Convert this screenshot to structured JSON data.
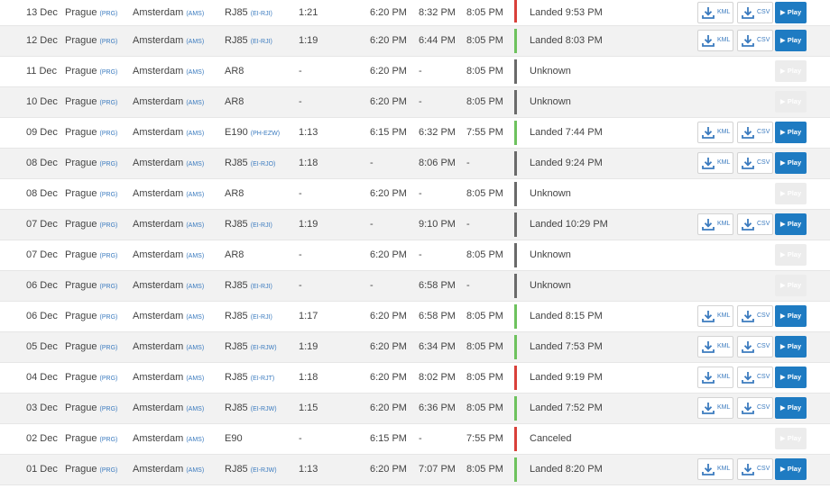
{
  "colors": {
    "landed": "#6ec25e",
    "late": "#d9403a",
    "unknown": "#6a6a6a",
    "play": "#1e7bc2",
    "code": "#3b7bbf"
  },
  "icons": {
    "download": "download-icon",
    "play": "play-triangle-icon"
  },
  "labels": {
    "kml": "KML",
    "csv": "CSV",
    "play": "▶ Play"
  },
  "rows": [
    {
      "date": "13 Dec",
      "from": "Prague",
      "from_code": "(PRG)",
      "to": "Amsterdam",
      "to_code": "(AMS)",
      "aircraft": "RJ85",
      "reg": "(EI-RJI)",
      "flight_time": "1:21",
      "std": "6:20 PM",
      "atd": "8:32 PM",
      "sta": "8:05 PM",
      "status": "Landed 9:53 PM",
      "bar": "red",
      "downloads": true
    },
    {
      "date": "12 Dec",
      "from": "Prague",
      "from_code": "(PRG)",
      "to": "Amsterdam",
      "to_code": "(AMS)",
      "aircraft": "RJ85",
      "reg": "(EI-RJI)",
      "flight_time": "1:19",
      "std": "6:20 PM",
      "atd": "6:44 PM",
      "sta": "8:05 PM",
      "status": "Landed 8:03 PM",
      "bar": "green",
      "downloads": true
    },
    {
      "date": "11 Dec",
      "from": "Prague",
      "from_code": "(PRG)",
      "to": "Amsterdam",
      "to_code": "(AMS)",
      "aircraft": "AR8",
      "reg": "",
      "flight_time": "-",
      "std": "6:20 PM",
      "atd": "-",
      "sta": "8:05 PM",
      "status": "Unknown",
      "bar": "gray",
      "downloads": false
    },
    {
      "date": "10 Dec",
      "from": "Prague",
      "from_code": "(PRG)",
      "to": "Amsterdam",
      "to_code": "(AMS)",
      "aircraft": "AR8",
      "reg": "",
      "flight_time": "-",
      "std": "6:20 PM",
      "atd": "-",
      "sta": "8:05 PM",
      "status": "Unknown",
      "bar": "gray",
      "downloads": false
    },
    {
      "date": "09 Dec",
      "from": "Prague",
      "from_code": "(PRG)",
      "to": "Amsterdam",
      "to_code": "(AMS)",
      "aircraft": "E190",
      "reg": "(PH-EZW)",
      "flight_time": "1:13",
      "std": "6:15 PM",
      "atd": "6:32 PM",
      "sta": "7:55 PM",
      "status": "Landed 7:44 PM",
      "bar": "green",
      "downloads": true
    },
    {
      "date": "08 Dec",
      "from": "Prague",
      "from_code": "(PRG)",
      "to": "Amsterdam",
      "to_code": "(AMS)",
      "aircraft": "RJ85",
      "reg": "(EI-RJO)",
      "flight_time": "1:18",
      "std": "-",
      "atd": "8:06 PM",
      "sta": "-",
      "status": "Landed 9:24 PM",
      "bar": "gray",
      "downloads": true
    },
    {
      "date": "08 Dec",
      "from": "Prague",
      "from_code": "(PRG)",
      "to": "Amsterdam",
      "to_code": "(AMS)",
      "aircraft": "AR8",
      "reg": "",
      "flight_time": "-",
      "std": "6:20 PM",
      "atd": "-",
      "sta": "8:05 PM",
      "status": "Unknown",
      "bar": "gray",
      "downloads": false
    },
    {
      "date": "07 Dec",
      "from": "Prague",
      "from_code": "(PRG)",
      "to": "Amsterdam",
      "to_code": "(AMS)",
      "aircraft": "RJ85",
      "reg": "(EI-RJI)",
      "flight_time": "1:19",
      "std": "-",
      "atd": "9:10 PM",
      "sta": "-",
      "status": "Landed 10:29 PM",
      "bar": "gray",
      "downloads": true
    },
    {
      "date": "07 Dec",
      "from": "Prague",
      "from_code": "(PRG)",
      "to": "Amsterdam",
      "to_code": "(AMS)",
      "aircraft": "AR8",
      "reg": "",
      "flight_time": "-",
      "std": "6:20 PM",
      "atd": "-",
      "sta": "8:05 PM",
      "status": "Unknown",
      "bar": "gray",
      "downloads": false
    },
    {
      "date": "06 Dec",
      "from": "Prague",
      "from_code": "(PRG)",
      "to": "Amsterdam",
      "to_code": "(AMS)",
      "aircraft": "RJ85",
      "reg": "(EI-RJI)",
      "flight_time": "-",
      "std": "-",
      "atd": "6:58 PM",
      "sta": "-",
      "status": "Unknown",
      "bar": "gray",
      "downloads": false
    },
    {
      "date": "06 Dec",
      "from": "Prague",
      "from_code": "(PRG)",
      "to": "Amsterdam",
      "to_code": "(AMS)",
      "aircraft": "RJ85",
      "reg": "(EI-RJI)",
      "flight_time": "1:17",
      "std": "6:20 PM",
      "atd": "6:58 PM",
      "sta": "8:05 PM",
      "status": "Landed 8:15 PM",
      "bar": "green",
      "downloads": true
    },
    {
      "date": "05 Dec",
      "from": "Prague",
      "from_code": "(PRG)",
      "to": "Amsterdam",
      "to_code": "(AMS)",
      "aircraft": "RJ85",
      "reg": "(EI-RJW)",
      "flight_time": "1:19",
      "std": "6:20 PM",
      "atd": "6:34 PM",
      "sta": "8:05 PM",
      "status": "Landed 7:53 PM",
      "bar": "green",
      "downloads": true
    },
    {
      "date": "04 Dec",
      "from": "Prague",
      "from_code": "(PRG)",
      "to": "Amsterdam",
      "to_code": "(AMS)",
      "aircraft": "RJ85",
      "reg": "(EI-RJT)",
      "flight_time": "1:18",
      "std": "6:20 PM",
      "atd": "8:02 PM",
      "sta": "8:05 PM",
      "status": "Landed 9:19 PM",
      "bar": "red",
      "downloads": true
    },
    {
      "date": "03 Dec",
      "from": "Prague",
      "from_code": "(PRG)",
      "to": "Amsterdam",
      "to_code": "(AMS)",
      "aircraft": "RJ85",
      "reg": "(EI-RJW)",
      "flight_time": "1:15",
      "std": "6:20 PM",
      "atd": "6:36 PM",
      "sta": "8:05 PM",
      "status": "Landed 7:52 PM",
      "bar": "green",
      "downloads": true
    },
    {
      "date": "02 Dec",
      "from": "Prague",
      "from_code": "(PRG)",
      "to": "Amsterdam",
      "to_code": "(AMS)",
      "aircraft": "E90",
      "reg": "",
      "flight_time": "-",
      "std": "6:15 PM",
      "atd": "-",
      "sta": "7:55 PM",
      "status": "Canceled",
      "bar": "red",
      "downloads": false
    },
    {
      "date": "01 Dec",
      "from": "Prague",
      "from_code": "(PRG)",
      "to": "Amsterdam",
      "to_code": "(AMS)",
      "aircraft": "RJ85",
      "reg": "(EI-RJW)",
      "flight_time": "1:13",
      "std": "6:20 PM",
      "atd": "7:07 PM",
      "sta": "8:05 PM",
      "status": "Landed 8:20 PM",
      "bar": "green",
      "downloads": true
    }
  ]
}
